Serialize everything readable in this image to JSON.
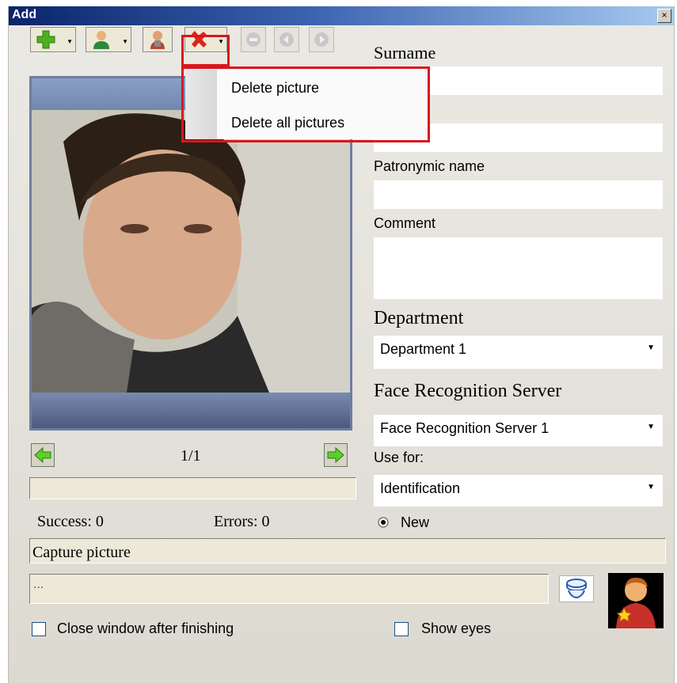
{
  "window": {
    "title": "Add",
    "close_glyph": "×"
  },
  "toolbar": {
    "add_icon": "green-plus-icon",
    "user_icon": "user-icon",
    "person_icon": "person-camera-icon",
    "delete_icon": "red-x-icon",
    "disabled_icons": [
      "stop-icon",
      "rewind-icon",
      "forward-icon"
    ]
  },
  "delete_menu": {
    "items": [
      "Delete picture",
      "Delete all pictures"
    ]
  },
  "gallery": {
    "counter": "1/1",
    "prev_icon": "left-arrow-icon",
    "next_icon": "right-arrow-icon"
  },
  "stats": {
    "success": "Success: 0",
    "errors": "Errors: 0"
  },
  "form": {
    "surname_label": "Surname",
    "patronymic_label": "Patronymic name",
    "comment_label": "Comment",
    "department_label": "Department",
    "department_value": "Department 1",
    "server_label": "Face Recognition Server",
    "server_value": "Face Recognition Server 1",
    "use_for_label": "Use for:",
    "use_for_value": "Identification",
    "new_radio_label": "New"
  },
  "capture": {
    "label": "Capture picture",
    "path_value": "..."
  },
  "options": {
    "close_window_label": "Close window after finishing",
    "show_eyes_label": "Show eyes"
  },
  "colors": {
    "highlight": "#d9161d",
    "titlebar": "#0a246a"
  }
}
